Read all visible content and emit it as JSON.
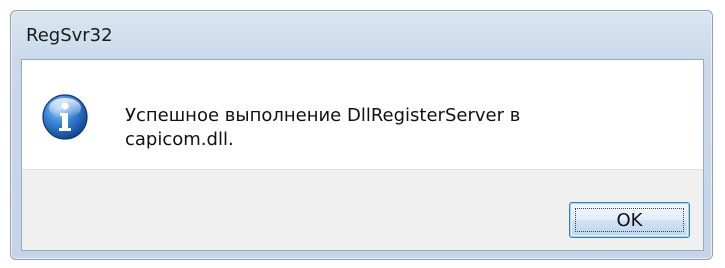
{
  "window": {
    "title": "RegSvr32"
  },
  "message": {
    "line1": "Успешное выполнение DllRegisterServer в",
    "line2": "capicom.dll.",
    "icon": "information-icon"
  },
  "buttons": {
    "ok_label": "OK"
  },
  "colors": {
    "frame": "#c9d9ea",
    "button_area": "#f0f0f0",
    "button_border": "#3c7fb1",
    "icon_blue": "#2d6fc2"
  }
}
